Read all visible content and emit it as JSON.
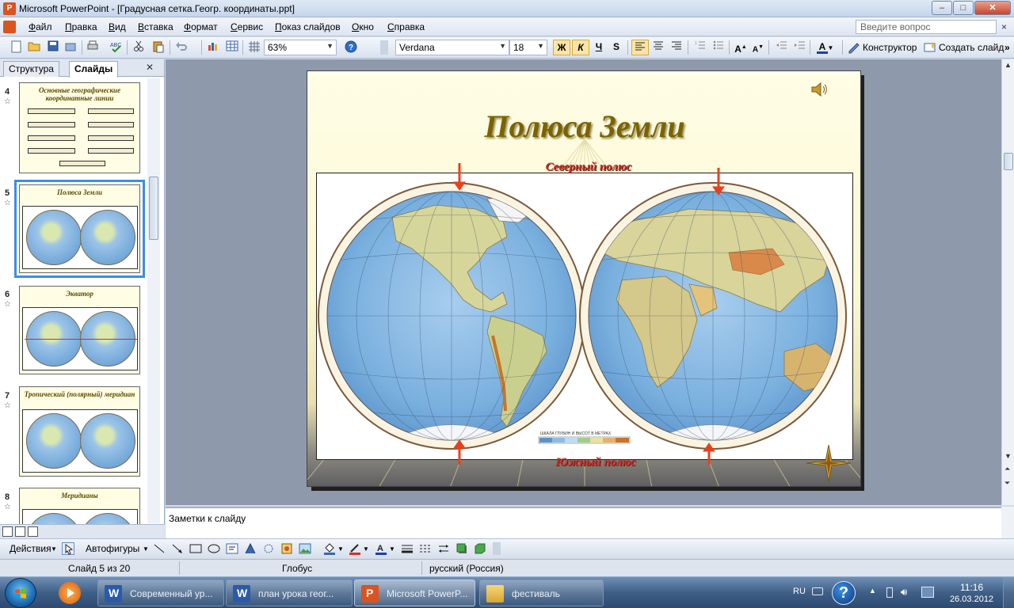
{
  "window": {
    "title": "Microsoft PowerPoint - [Градусная сетка.Геогр. координаты.ppt]",
    "min": "–",
    "max": "□",
    "close": "✕"
  },
  "menu": {
    "items": [
      "Файл",
      "Правка",
      "Вид",
      "Вставка",
      "Формат",
      "Сервис",
      "Показ слайдов",
      "Окно",
      "Справка"
    ],
    "ask_placeholder": "Введите вопрос",
    "close": "×"
  },
  "toolbar": {
    "zoom": "63%",
    "font": "Verdana",
    "size": "18",
    "bold": "Ж",
    "italic": "К",
    "underline": "Ч",
    "shadow": "S",
    "designer": "Конструктор",
    "new_slide": "Создать слайд",
    "more": "»"
  },
  "panel": {
    "tabs": [
      "Структура",
      "Слайды"
    ],
    "close": "✕",
    "thumbnails": [
      {
        "num": "4",
        "title": "Основные географические координатные линии"
      },
      {
        "num": "5",
        "title": "Полюса Земли"
      },
      {
        "num": "6",
        "title": "Экватор"
      },
      {
        "num": "7",
        "title": "Тропический (полярный) меридиан"
      },
      {
        "num": "8",
        "title": "Меридианы"
      }
    ],
    "selected": "5"
  },
  "slide": {
    "title": "Полюса Земли",
    "north_label": "Северный полюс",
    "south_label": "Южный полюс",
    "map_legend": "ШКАЛА ГЛУБИН И ВЫСОТ В МЕТРАХ"
  },
  "notes": {
    "placeholder": "Заметки к слайду"
  },
  "drawing": {
    "actions": "Действия",
    "autoshapes": "Автофигуры"
  },
  "status": {
    "slide": "Слайд 5 из 20",
    "design": "Глобус",
    "language": "русский (Россия)"
  },
  "taskbar": {
    "items": [
      {
        "label": "Современный ур...",
        "app": "word"
      },
      {
        "label": "план урока геог...",
        "app": "word"
      },
      {
        "label": "Microsoft PowerP...",
        "app": "powerpoint"
      },
      {
        "label": "фестиваль",
        "app": "folder"
      }
    ],
    "lang": "RU",
    "time": "11:16",
    "date": "26.03.2012"
  },
  "colors": {
    "title_gold": "#7a6300",
    "pole_label_red": "#c8322a",
    "arrow_red": "#e8401e",
    "ocean_blue": "#7ab0de",
    "selection_blue": "#3a8ee6"
  }
}
